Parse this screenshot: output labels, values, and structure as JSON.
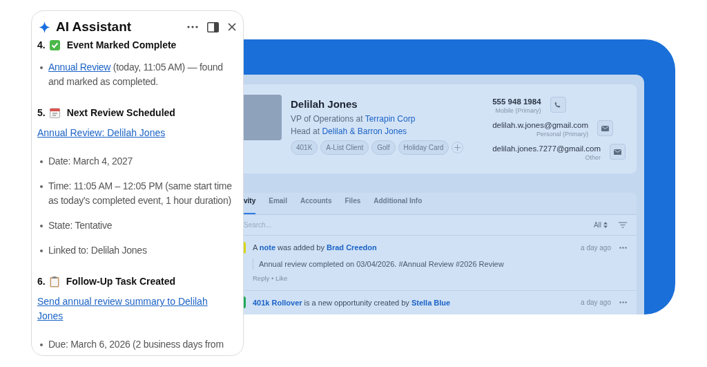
{
  "assistant": {
    "title": "AI Assistant",
    "blocks": [
      {
        "kind": "heading",
        "number": "4.",
        "text": "Event Marked Complete"
      },
      {
        "kind": "bullet",
        "segments": [
          {
            "text": "Annual Review",
            "link": true
          },
          {
            "text": " (today, 11:05 AM) — found and marked as completed.",
            "link": false
          }
        ]
      },
      {
        "kind": "heading",
        "number": "5.",
        "text": "Next Review Scheduled"
      },
      {
        "kind": "link",
        "text": "Annual Review: Delilah Jones"
      },
      {
        "kind": "bullet",
        "segments": [
          {
            "text": "Date: March 4, 2027",
            "link": false
          }
        ]
      },
      {
        "kind": "bullet",
        "segments": [
          {
            "text": "Time: 11:05 AM – 12:05 PM (same start time as today's completed event, 1 hour duration)",
            "link": false
          }
        ]
      },
      {
        "kind": "bullet",
        "segments": [
          {
            "text": "State: Tentative",
            "link": false
          }
        ]
      },
      {
        "kind": "bullet",
        "segments": [
          {
            "text": "Linked to: Delilah Jones",
            "link": false
          }
        ]
      },
      {
        "kind": "heading",
        "number": "6.",
        "text": "Follow-Up Task Created"
      },
      {
        "kind": "link",
        "text": "Send annual review summary to Delilah Jones"
      },
      {
        "kind": "bullet",
        "segments": [
          {
            "text": "Due: March 6, 2026 (2 business days from",
            "link": false
          }
        ]
      }
    ]
  },
  "contact": {
    "name": "Delilah Jones",
    "lines": [
      {
        "text": "VP of Operations at ",
        "link": "Terrapin Corp"
      },
      {
        "text": "Head at ",
        "link": "Delilah & Barron Jones"
      }
    ],
    "tags": [
      "401K",
      "A-List Client",
      "Golf",
      "Holiday Card"
    ],
    "details": [
      {
        "kind": "phone",
        "value": "555 948 1984",
        "label": "Mobile (Primary)"
      },
      {
        "kind": "email",
        "value": "delilah.w.jones@gmail.com",
        "label": "Personal (Primary)"
      },
      {
        "kind": "email",
        "value": "delilah.jones.7277@gmail.com",
        "label": "Other"
      }
    ]
  },
  "tabs": [
    {
      "label": "vity",
      "selected": true
    },
    {
      "label": "Email",
      "selected": false
    },
    {
      "label": "Accounts",
      "selected": false
    },
    {
      "label": "Files",
      "selected": false
    },
    {
      "label": "Additional Info",
      "selected": false
    }
  ],
  "search": {
    "placeholder": "Search...",
    "filter": "All"
  },
  "activities": [
    {
      "color": "#d6d31a",
      "segments": [
        {
          "text": "A ",
          "link": false
        },
        {
          "text": "note",
          "link": true
        },
        {
          "text": " was added by ",
          "link": false
        },
        {
          "text": "Brad Creedon",
          "link": true
        }
      ],
      "time": "a day ago",
      "note": "Annual review completed on 03/04/2026. #Annual Review #2026 Review",
      "actions": "Reply • Like"
    },
    {
      "color": "#22a85a",
      "segments": [
        {
          "text": "401k Rollover",
          "link": true
        },
        {
          "text": " is a new opportunity created by ",
          "link": false
        },
        {
          "text": "Stella Blue",
          "link": true
        }
      ],
      "time": "a day ago"
    }
  ]
}
